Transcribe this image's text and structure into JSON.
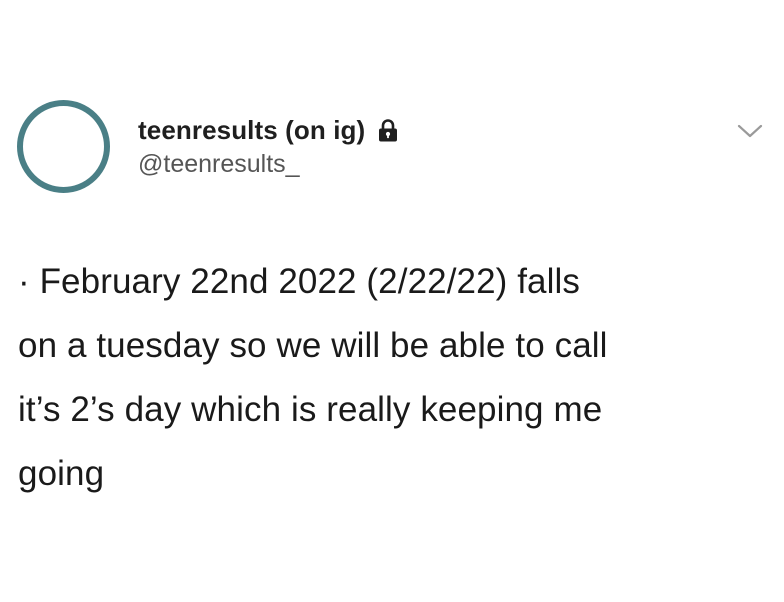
{
  "tweet": {
    "user": {
      "display_name": "teenresults (on ig)",
      "handle": "@teenresults_",
      "avatar_ring_color": "#4a7f86",
      "protected_icon": "lock-icon"
    },
    "menu_icon": "chevron-down-icon",
    "text_lines": [
      "· February 22nd 2022 (2/22/22) falls",
      "on a tuesday so we will be able to call",
      "it’s 2’s day which is really keeping me",
      "going"
    ]
  }
}
